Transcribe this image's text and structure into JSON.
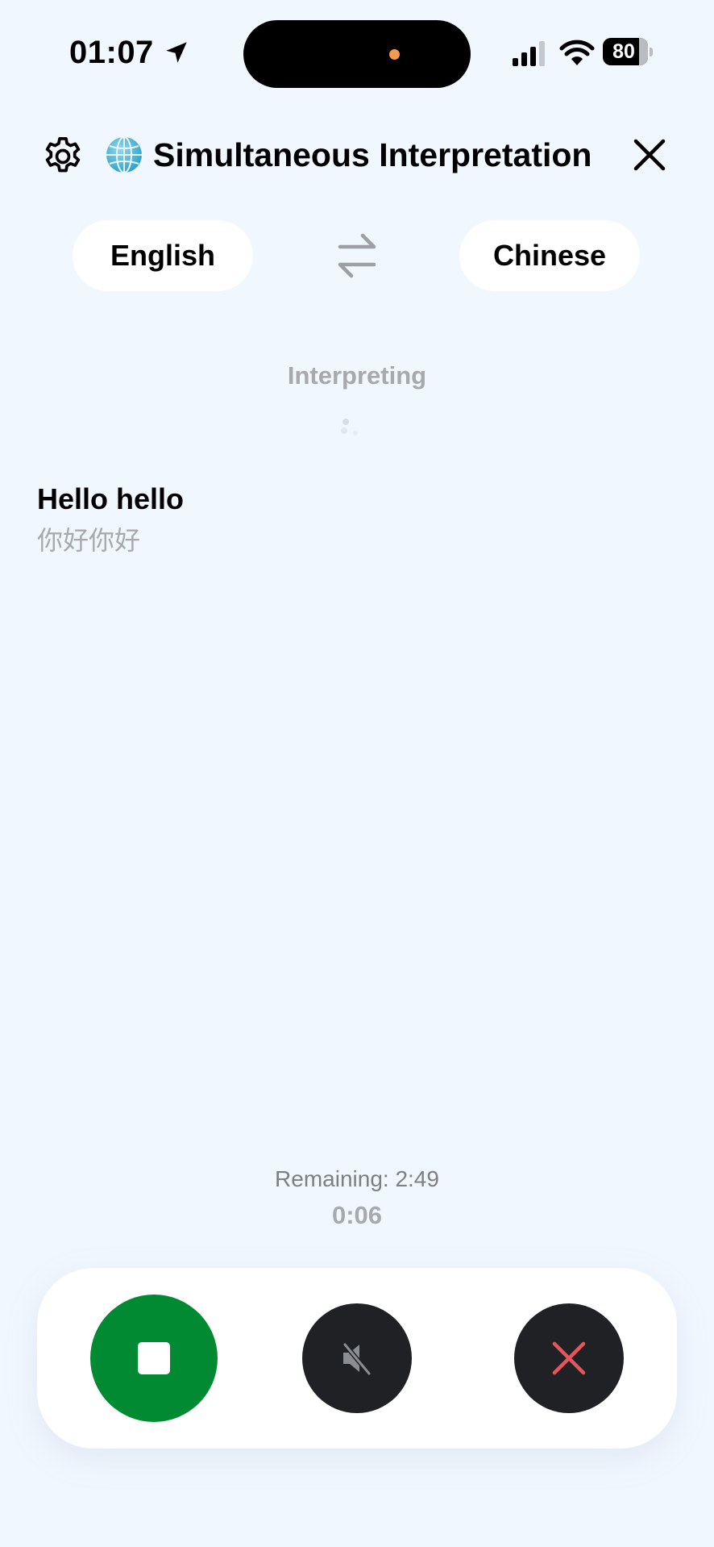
{
  "status_bar": {
    "time": "01:07",
    "battery": "80",
    "icons": [
      "location-arrow-icon",
      "signal-bars-icon",
      "wifi-icon",
      "battery-charging-icon"
    ]
  },
  "header": {
    "title": "Simultaneous Interpretation",
    "icons": [
      "gear-icon",
      "globe-icon",
      "close-icon"
    ]
  },
  "languages": {
    "source": "English",
    "target": "Chinese",
    "swap_icon": "swap-arrows-icon"
  },
  "status": {
    "label": "Interpreting"
  },
  "transcript": {
    "source_text": "Hello hello",
    "translated_text": "你好你好"
  },
  "timer": {
    "remaining": "Remaining: 2:49",
    "elapsed": "0:06"
  },
  "controls": {
    "stop_icon": "stop-icon",
    "mute_icon": "speaker-muted-icon",
    "cancel_icon": "close-icon",
    "colors": {
      "stop": "#018a32",
      "dark": "#202124",
      "cancel_x": "#e5555b"
    }
  },
  "colors": {
    "background": "#f1f7fe",
    "muted_text": "#a6a9ad"
  }
}
